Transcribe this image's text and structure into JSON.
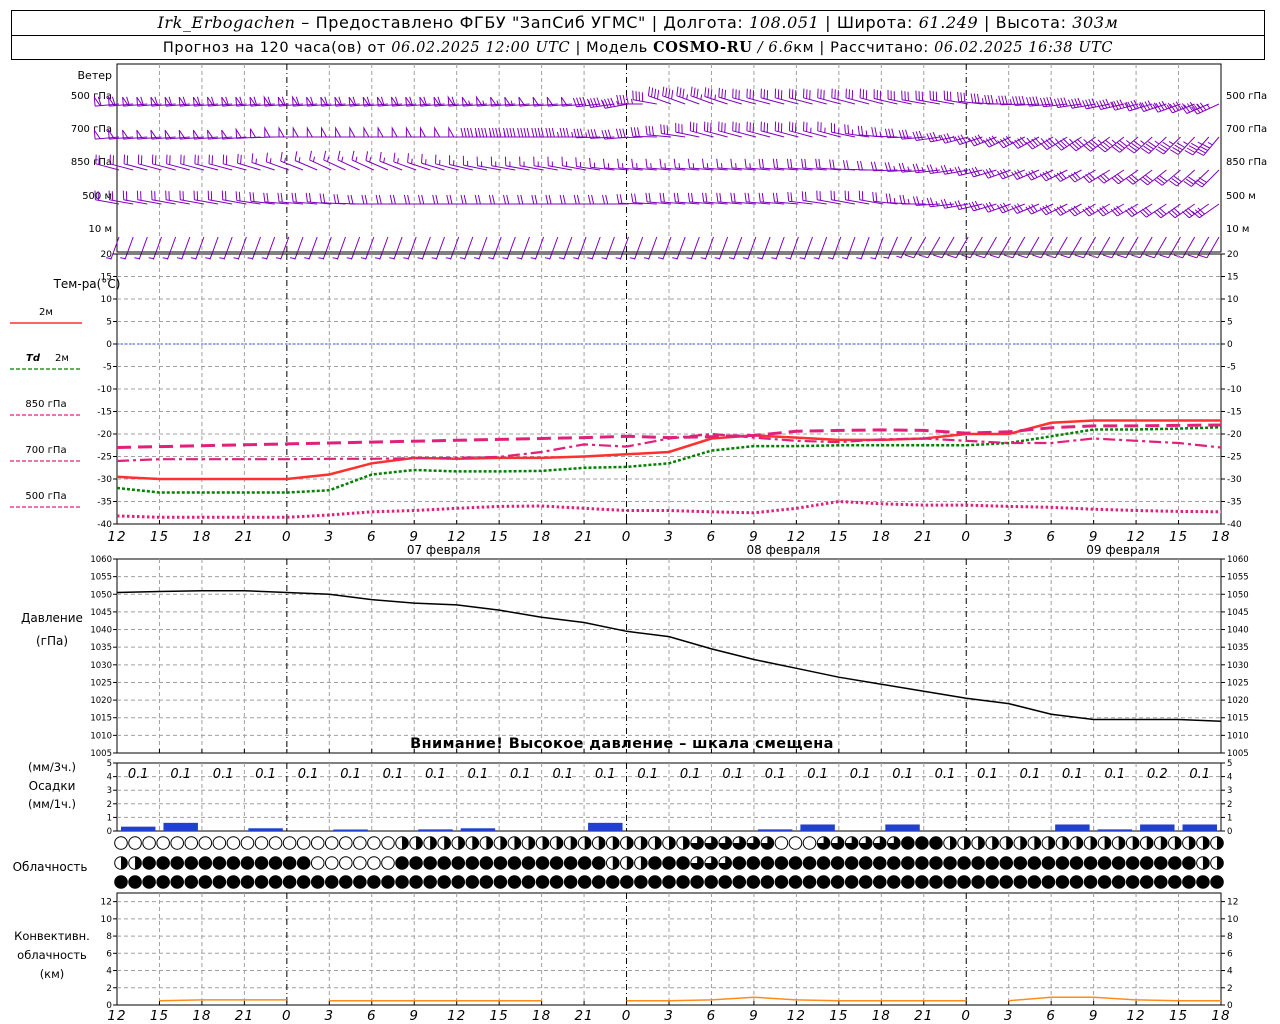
{
  "header": {
    "station": "Irk_Erbogachen",
    "dash": "–",
    "provider": "Предоставлено ФГБУ \"ЗапСиб УГМС\"",
    "sep": "|",
    "lon_label": "Долгота:",
    "lon_value": "108.051",
    "lat_label": "Широта:",
    "lat_value": "61.249",
    "alt_label": "Высота:",
    "alt_value": "303м",
    "forecast_label": "Прогноз на 120 часа(ов) от",
    "forecast_start": "06.02.2025 12:00 UTC",
    "model_label": "Модель",
    "model_name": "COSMO-RU",
    "model_res": "/ 6.6",
    "model_res_unit": "км",
    "calc_label": "Рассчитано:",
    "calc_time": "06.02.2025 16:38 UTC"
  },
  "labels": {
    "wind": "Ветер",
    "wind_levels": [
      "500 гПа",
      "700 гПа",
      "850 гПа",
      "500 м",
      "10 м"
    ],
    "temp_title": "Тем-ра(°С)",
    "temp_legend": [
      "2м",
      "Td 2м",
      "850 гПа",
      "700 гПа",
      "500 гПа"
    ],
    "pressure_title": [
      "Давление",
      "(гПа)"
    ],
    "pressure_warning": "Внимание! Высокое давление – шкала смещена",
    "precip_title": [
      "(мм/3ч.)",
      "Осадки",
      "(мм/1ч.)"
    ],
    "cloud_title": "Облачность",
    "conv_title": [
      "Конвективн.",
      "облачность",
      "(км)"
    ]
  },
  "colors": {
    "wind": "#8000c0",
    "t2m": "#ff3030",
    "td2m": "#008000",
    "t850": "#e0207a",
    "t700": "#e0207a",
    "t500": "#e0207a",
    "zero_line": "#3050ff",
    "precip": "#2040d0",
    "conv": "#ff8c1a",
    "grid": "#a0a0a0"
  },
  "chart_data": {
    "x_hours": [
      12,
      15,
      18,
      21,
      0,
      3,
      6,
      9,
      12,
      15,
      18,
      21,
      0,
      3,
      6,
      9,
      12,
      15,
      18,
      21,
      0,
      3,
      6,
      9,
      12,
      15,
      18
    ],
    "date_labels": [
      {
        "index": 8,
        "text": "07 февраля"
      },
      {
        "index": 16,
        "text": "08 февраля"
      },
      {
        "index": 24,
        "text": "09 февраля"
      }
    ],
    "day_breaks": [
      4,
      12,
      20
    ],
    "temperature": {
      "type": "line",
      "ylim": [
        -40,
        20
      ],
      "yticks": [
        20,
        15,
        10,
        5,
        0,
        -5,
        -10,
        -15,
        -20,
        -25,
        -30,
        -35,
        -40
      ],
      "series": [
        {
          "name": "2м",
          "values": [
            -29.5,
            -30,
            -30,
            -30,
            -30,
            -29,
            -26.5,
            -25.3,
            -25.5,
            -25.3,
            -25.3,
            -25,
            -24.5,
            -24,
            -21,
            -20.3,
            -20.8,
            -21.3,
            -21.3,
            -21,
            -20,
            -20,
            -17.5,
            -17,
            -17,
            -17,
            -17
          ]
        },
        {
          "name": "Td 2м",
          "values": [
            -32,
            -33,
            -33,
            -33,
            -33,
            -32.5,
            -29,
            -28,
            -28.3,
            -28.3,
            -28.2,
            -27.5,
            -27.3,
            -26.5,
            -23.7,
            -22.7,
            -22.7,
            -22.5,
            -22.5,
            -22.5,
            -22.5,
            -22,
            -20.5,
            -19,
            -19,
            -18.8,
            -18.5
          ]
        },
        {
          "name": "850 гПа",
          "values": [
            -23,
            -22.8,
            -22.6,
            -22.4,
            -22.2,
            -22,
            -21.8,
            -21.6,
            -21.4,
            -21.2,
            -21,
            -20.8,
            -20.5,
            -20.8,
            -20.6,
            -20.3,
            -19.4,
            -19.2,
            -19.1,
            -19.2,
            -19.8,
            -19.5,
            -18.6,
            -18.2,
            -18.2,
            -18.1,
            -18
          ]
        },
        {
          "name": "700 гПа",
          "values": [
            -26,
            -25.6,
            -25.6,
            -25.6,
            -25.6,
            -25.5,
            -25.5,
            -25.4,
            -25.3,
            -25.1,
            -24,
            -22.3,
            -22.8,
            -21,
            -20,
            -20.8,
            -21.5,
            -21.8,
            -21.2,
            -21,
            -21.5,
            -22,
            -22,
            -21,
            -21.5,
            -22,
            -23
          ]
        },
        {
          "name": "500 гПа",
          "values": [
            -38.2,
            -38.5,
            -38.5,
            -38.5,
            -38.5,
            -38,
            -37.3,
            -37,
            -36.5,
            -36.1,
            -36,
            -36.5,
            -37,
            -37,
            -37.3,
            -37.5,
            -36.5,
            -35,
            -35.5,
            -35.8,
            -35.8,
            -36.1,
            -36.3,
            -36.7,
            -37,
            -37.2,
            -37.3
          ]
        }
      ]
    },
    "pressure": {
      "type": "line",
      "ylim": [
        1005,
        1060
      ],
      "yticks": [
        1060,
        1055,
        1050,
        1045,
        1040,
        1035,
        1030,
        1025,
        1020,
        1015,
        1010,
        1005
      ],
      "values": [
        1050.5,
        1050.8,
        1051,
        1051,
        1050.5,
        1050,
        1048.5,
        1047.5,
        1047,
        1045.5,
        1043.5,
        1042,
        1039.5,
        1038,
        1034.5,
        1031.5,
        1029,
        1026.5,
        1024.5,
        1022.5,
        1020.5,
        1019,
        1016,
        1014.5,
        1014.5,
        1014.5,
        1014
      ]
    },
    "precip": {
      "type": "bar",
      "ylim": [
        0,
        5
      ],
      "yticks": [
        5,
        4,
        3,
        2,
        1,
        0
      ],
      "labels": [
        "0.1",
        "0.1",
        "0.1",
        "0.1",
        "0.1",
        "0.1",
        "0.1",
        "0.1",
        "0.1",
        "0.1",
        "0.1",
        "0.1",
        "0.1",
        "0.1",
        "0.1",
        "0.1",
        "0.1",
        "0.1",
        "0.1",
        "0.1",
        "0.1",
        "0.1",
        "0.1",
        "0.1",
        "0.2",
        "0.1"
      ],
      "hourly_mm": [
        0.08,
        0.15,
        0,
        0.05,
        0,
        0.02,
        0,
        0.03,
        0.05,
        0,
        0,
        0.15,
        0,
        0,
        0,
        0.03,
        0.12,
        0,
        0.12,
        0,
        0,
        0,
        0.12,
        0.03,
        0.12,
        0.12
      ]
    },
    "clouds": {
      "note": "Cloud cover in eighths for three layers (upper row = high, middle = medium, bottom = low)",
      "high": [
        0,
        0,
        0,
        0,
        0,
        0,
        0,
        4,
        4,
        4,
        4,
        4,
        4,
        4,
        6,
        6,
        0,
        6,
        6,
        8,
        4,
        4,
        4,
        4,
        4,
        4,
        4
      ],
      "mid": [
        4,
        8,
        8,
        8,
        8,
        0,
        0,
        8,
        8,
        8,
        8,
        8,
        4,
        8,
        6,
        8,
        8,
        8,
        8,
        8,
        8,
        8,
        8,
        8,
        8,
        8,
        4
      ],
      "low": [
        8,
        8,
        8,
        8,
        8,
        8,
        8,
        8,
        8,
        8,
        8,
        8,
        8,
        8,
        8,
        8,
        8,
        8,
        8,
        8,
        8,
        8,
        8,
        8,
        8,
        8,
        8
      ]
    },
    "convective": {
      "type": "area",
      "ylim": [
        0,
        13
      ],
      "yticks": [
        12,
        10,
        8,
        6,
        4,
        2,
        0
      ],
      "values": [
        0,
        0.5,
        0.6,
        0.6,
        0,
        0.5,
        0.5,
        0.5,
        0.5,
        0.5,
        0,
        0,
        0.5,
        0.5,
        0.6,
        0.9,
        0.6,
        0.5,
        0.5,
        0.5,
        0,
        0.5,
        0.9,
        0.9,
        0.6,
        0.5,
        0.5
      ]
    },
    "wind": {
      "type": "wind-barbs",
      "levels": [
        "500 гПа",
        "700 гПа",
        "850 гПа",
        "500 м",
        "10 м"
      ],
      "direction_deg": [
        [
          265,
          265,
          265,
          265,
          265,
          265,
          265,
          265,
          265,
          265,
          265,
          265,
          260,
          290,
          290,
          285,
          285,
          285,
          285,
          280,
          280,
          270,
          265,
          260,
          255,
          250,
          245
        ],
        [
          265,
          265,
          265,
          265,
          270,
          270,
          270,
          270,
          270,
          270,
          270,
          270,
          265,
          275,
          285,
          285,
          285,
          285,
          275,
          265,
          255,
          245,
          240,
          235,
          230,
          225,
          220
        ],
        [
          285,
          285,
          285,
          285,
          290,
          295,
          295,
          290,
          285,
          280,
          280,
          280,
          275,
          275,
          275,
          275,
          275,
          275,
          270,
          265,
          260,
          250,
          245,
          240,
          235,
          230,
          225
        ],
        [
          280,
          280,
          280,
          280,
          275,
          275,
          270,
          270,
          270,
          270,
          270,
          270,
          270,
          275,
          275,
          275,
          275,
          280,
          280,
          270,
          260,
          250,
          245,
          240,
          240,
          235,
          235
        ],
        [
          200,
          200,
          200,
          200,
          200,
          200,
          200,
          200,
          200,
          200,
          200,
          200,
          200,
          200,
          200,
          200,
          200,
          200,
          200,
          210,
          210,
          210,
          210,
          210,
          210,
          210,
          210
        ]
      ],
      "speed_ms": [
        [
          30,
          30,
          30,
          30,
          30,
          30,
          30,
          30,
          30,
          28,
          26,
          24,
          22,
          20,
          18,
          15,
          15,
          15,
          15,
          15,
          15,
          18,
          20,
          20,
          22,
          22,
          22
        ],
        [
          25,
          25,
          25,
          25,
          25,
          25,
          25,
          25,
          25,
          23,
          20,
          18,
          15,
          15,
          15,
          15,
          15,
          13,
          13,
          15,
          18,
          20,
          22,
          22,
          22,
          22,
          22
        ],
        [
          10,
          10,
          10,
          10,
          8,
          8,
          8,
          8,
          8,
          8,
          8,
          8,
          8,
          8,
          8,
          8,
          10,
          10,
          10,
          12,
          13,
          15,
          15,
          15,
          15,
          15,
          15
        ],
        [
          10,
          10,
          10,
          10,
          10,
          10,
          10,
          10,
          10,
          10,
          10,
          10,
          10,
          10,
          10,
          10,
          10,
          10,
          10,
          12,
          13,
          15,
          15,
          15,
          15,
          15,
          15
        ],
        [
          3,
          3,
          3,
          3,
          3,
          3,
          3,
          3,
          3,
          3,
          3,
          3,
          3,
          3,
          3,
          3,
          3,
          3,
          3,
          4,
          5,
          5,
          5,
          5,
          5,
          5,
          5
        ]
      ]
    }
  }
}
